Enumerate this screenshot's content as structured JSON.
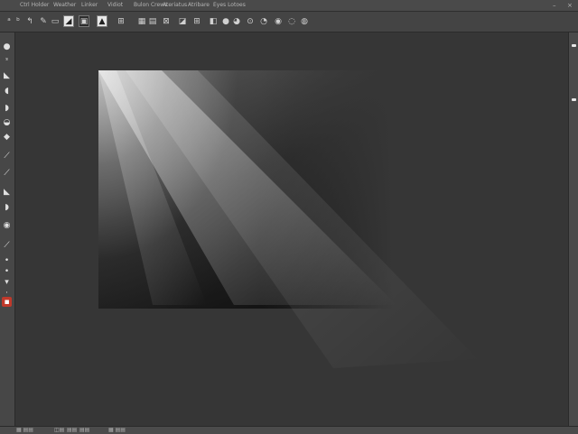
{
  "menubar": {
    "items": [
      {
        "label": "Ctrl Holder"
      },
      {
        "label": "Weather"
      },
      {
        "label": "Linker"
      },
      {
        "label": "Vidiot"
      },
      {
        "label": "Bulon Crews"
      },
      {
        "label": "Ateriatus"
      },
      {
        "label": "Atribare"
      },
      {
        "label": "Eyes Lotoes"
      }
    ]
  },
  "icons": {
    "options": [
      "arrow-icon",
      "move-icon",
      "rect-select-icon",
      "gradient-icon",
      "layer-icon",
      "doc-icon",
      "brush-icon",
      "contrast-icon",
      "stamp-icon",
      "eraser-icon",
      "fill-icon",
      "blur-icon",
      "dodge-icon",
      "zoom-icon"
    ],
    "tools": [
      "ellipse-tool-icon",
      "lasso-icon",
      "crop-icon",
      "eyedropper-icon",
      "spot-heal-icon",
      "brush-icon",
      "clone-icon",
      "history-icon",
      "eraser-icon",
      "gradient-icon",
      "dodge-icon",
      "pen-icon",
      "type-icon",
      "path-select-icon",
      "shape-icon",
      "hand-icon",
      "zoom-icon",
      "color-swatch-icon"
    ]
  },
  "colors": {
    "ui_dark": "#3a3a3a",
    "canvas_bg": "#363636",
    "swatch_red": "#c0392b"
  }
}
